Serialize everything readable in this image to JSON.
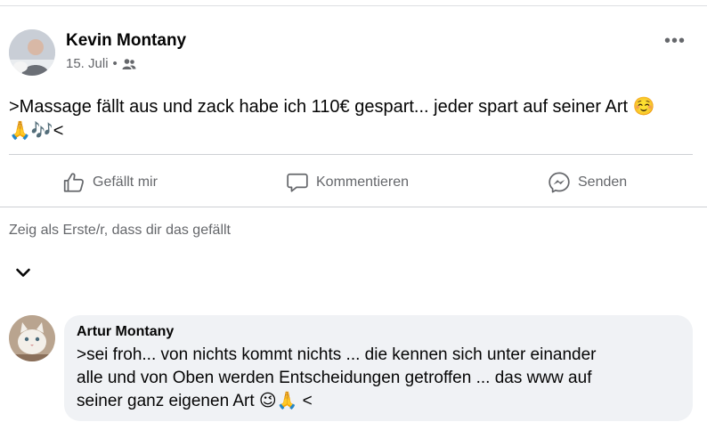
{
  "post": {
    "author": "Kevin Montany",
    "date": "15. Juli",
    "separator": "•",
    "audience_icon": "friends-icon",
    "more_label": "•••",
    "text_line1": ">Massage fällt aus und zack habe ich 110€ gespart... jeder spart auf seiner Art ☺️",
    "text_line2": "🙏🎶<"
  },
  "actions": {
    "like_label": "Gefällt mir",
    "comment_label": "Kommentieren",
    "send_label": "Senden"
  },
  "first_like_hint": "Zeig als Erste/r, dass dir das gefällt",
  "comment": {
    "author": "Artur Montany",
    "line1": ">sei froh... von nichts kommt nichts ... die kennen sich unter einander",
    "line2": "alle und von Oben werden Entscheidungen getroffen ... das www auf",
    "line3": "seiner ganz eigenen Art 😉🙏 <"
  },
  "colors": {
    "text": "#050505",
    "secondary_text": "#65676b",
    "divider": "#ced0d4",
    "bubble": "#f0f2f5"
  }
}
